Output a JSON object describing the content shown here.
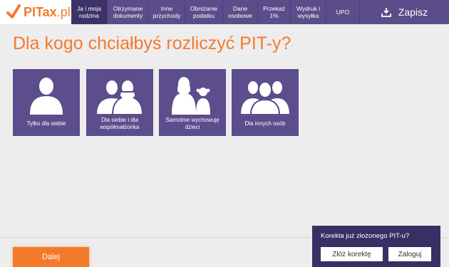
{
  "logo": {
    "brand": "PITax",
    "suffix": ".pl"
  },
  "nav": {
    "items": [
      {
        "label": "Ja i moja rodzina",
        "active": true
      },
      {
        "label": "Otrzymane dokumenty",
        "active": false
      },
      {
        "label": "Inne przychody",
        "active": false
      },
      {
        "label": "Obniżanie podatku",
        "active": false
      },
      {
        "label": "Dane osobowe",
        "active": false
      },
      {
        "label": "Przekaż 1%",
        "active": false
      },
      {
        "label": "Wydruk i wysyłka",
        "active": false
      },
      {
        "label": "UPO",
        "active": false
      }
    ],
    "save_label": "Zapisz"
  },
  "main": {
    "title": "Dla kogo chciałbyś rozliczyć PIT-y?",
    "options": [
      {
        "label": "Tylko dla siebie",
        "icon": "single-person-icon"
      },
      {
        "label": "Dla siebie i dla współmałżonka",
        "icon": "couple-icon"
      },
      {
        "label": "Samotnie wychowuję dzieci",
        "icon": "parent-with-child-icon"
      },
      {
        "label": "Dla innych osób",
        "icon": "group-of-people-icon"
      }
    ]
  },
  "footer": {
    "next_label": "Dalej"
  },
  "correction": {
    "title": "Korekta już złożonego PIT-u?",
    "submit_label": "Złóż korektę",
    "login_label": "Zaloguj"
  },
  "colors": {
    "accent": "#f47a2b",
    "nav": "#5b4c8a",
    "nav_active": "#3d3268",
    "card": "#5c4d8d",
    "panel": "#3a2f63"
  }
}
